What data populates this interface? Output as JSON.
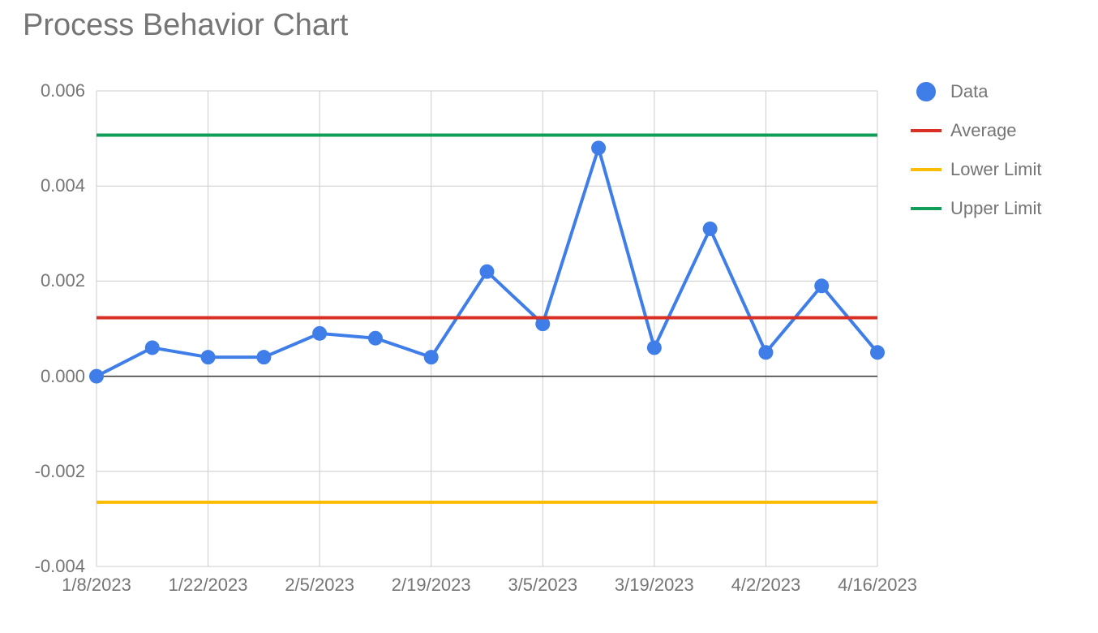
{
  "chart_data": {
    "type": "line",
    "title": "Process Behavior Chart",
    "xlabel": "",
    "ylabel": "",
    "ylim": [
      -0.004,
      0.006
    ],
    "x_ticks": [
      "1/8/2023",
      "1/22/2023",
      "2/5/2023",
      "2/19/2023",
      "3/5/2023",
      "3/19/2023",
      "4/2/2023",
      "4/16/2023"
    ],
    "y_ticks": [
      -0.004,
      -0.002,
      0.0,
      0.002,
      0.004,
      0.006
    ],
    "categories": [
      "1/8/2023",
      "1/15/2023",
      "1/22/2023",
      "1/29/2023",
      "2/5/2023",
      "2/12/2023",
      "2/19/2023",
      "2/26/2023",
      "3/5/2023",
      "3/12/2023",
      "3/19/2023",
      "3/26/2023",
      "4/2/2023",
      "4/9/2023",
      "4/16/2023"
    ],
    "series": [
      {
        "name": "Data",
        "color": "#3f7ee8",
        "show_markers": true,
        "values": [
          0.0,
          0.0006,
          0.0004,
          0.0004,
          0.0009,
          0.0008,
          0.0004,
          0.0022,
          0.0011,
          0.0048,
          0.0006,
          0.0031,
          0.0005,
          0.0019,
          0.0005
        ]
      },
      {
        "name": "Average",
        "color": "#d93025",
        "show_markers": false,
        "values": [
          0.00123,
          0.00123,
          0.00123,
          0.00123,
          0.00123,
          0.00123,
          0.00123,
          0.00123,
          0.00123,
          0.00123,
          0.00123,
          0.00123,
          0.00123,
          0.00123,
          0.00123
        ]
      },
      {
        "name": "Lower Limit",
        "color": "#fbbc04",
        "show_markers": false,
        "values": [
          -0.00265,
          -0.00265,
          -0.00265,
          -0.00265,
          -0.00265,
          -0.00265,
          -0.00265,
          -0.00265,
          -0.00265,
          -0.00265,
          -0.00265,
          -0.00265,
          -0.00265,
          -0.00265,
          -0.00265
        ]
      },
      {
        "name": "Upper Limit",
        "color": "#0f9d58",
        "show_markers": false,
        "values": [
          0.00507,
          0.00507,
          0.00507,
          0.00507,
          0.00507,
          0.00507,
          0.00507,
          0.00507,
          0.00507,
          0.00507,
          0.00507,
          0.00507,
          0.00507,
          0.00507,
          0.00507
        ]
      }
    ],
    "legend_position": "right"
  },
  "y_tick_labels": [
    "-0.004",
    "-0.002",
    "0.000",
    "0.002",
    "0.004",
    "0.006"
  ]
}
